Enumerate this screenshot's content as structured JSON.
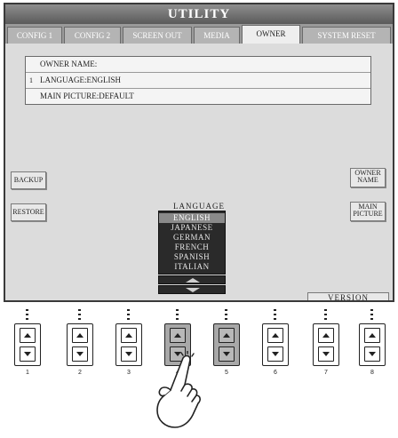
{
  "title": "UTILITY",
  "tabs": [
    {
      "label": "CONFIG 1",
      "active": false
    },
    {
      "label": "CONFIG 2",
      "active": false
    },
    {
      "label": "SCREEN OUT",
      "active": false
    },
    {
      "label": "MEDIA",
      "active": false
    },
    {
      "label": "OWNER",
      "active": true
    },
    {
      "label": "SYSTEM RESET",
      "active": false
    }
  ],
  "owner_list": {
    "index": "1",
    "rows": [
      {
        "label": "OWNER NAME:"
      },
      {
        "label": "LANGUAGE:ENGLISH"
      },
      {
        "label": "MAIN PICTURE:Default"
      }
    ]
  },
  "side_buttons": {
    "backup": "BACKUP",
    "restore": "RESTORE",
    "owner_name": [
      "OWNER",
      "NAME"
    ],
    "main_picture": [
      "MAIN",
      "PICTURE"
    ]
  },
  "language_selector": {
    "label": "LANGUAGE",
    "options": [
      "ENGLISH",
      "JAPANESE",
      "GERMAN",
      "FRENCH",
      "SPANISH",
      "ITALIAN"
    ],
    "selected": "ENGLISH"
  },
  "version_button": "VERSION",
  "panel_buttons": [
    {
      "number": "1",
      "pressed": false
    },
    {
      "number": "2",
      "pressed": false
    },
    {
      "number": "3",
      "pressed": false
    },
    {
      "number": "4",
      "pressed": true
    },
    {
      "number": "5",
      "pressed": true
    },
    {
      "number": "6",
      "pressed": false
    },
    {
      "number": "7",
      "pressed": false
    },
    {
      "number": "8",
      "pressed": false
    }
  ],
  "icons": {
    "scroll_up": "up-triangle-icon",
    "scroll_down": "down-triangle-icon",
    "pointer": "pointing-hand-icon"
  },
  "colors": {
    "screen_bg": "#dcdcdc",
    "title_bar": "#5a5a5a",
    "list_bg": "#2a2a2a",
    "selected_item": "#8a8a8a",
    "pressed_button": "#a8a8a8"
  }
}
